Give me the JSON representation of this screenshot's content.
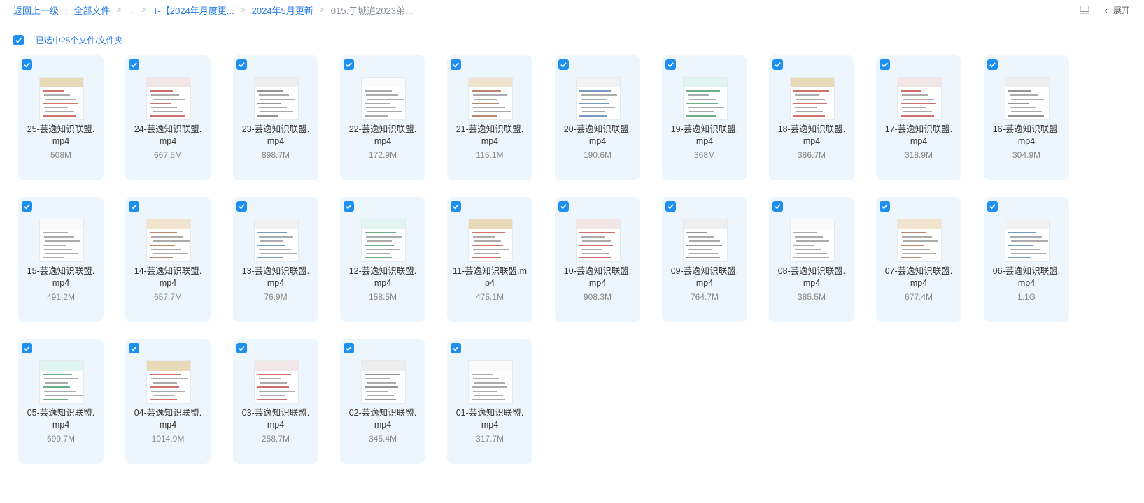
{
  "breadcrumb": {
    "back": "返回上一级",
    "all_files": "全部文件",
    "ellipsis": "...",
    "folder1": "T-【2024年月度更...",
    "folder2": "2024年5月更新",
    "current": "015.于城道2023弟..."
  },
  "toolbar": {
    "expand_label": "展开",
    "list_icon": "list-view-icon",
    "back_icon": "chevron-left-icon"
  },
  "selection": {
    "text": "已选中25个文件/文件夹",
    "checked": true
  },
  "colors": {
    "accent": "#2a7ee8",
    "card_bg": "#eef6fd",
    "checkbox": "#1f8fef"
  },
  "files": [
    {
      "name_line1": "25-芸逸知识联盟.",
      "name_line2": "mp4",
      "size": "508M"
    },
    {
      "name_line1": "24-芸逸知识联盟.",
      "name_line2": "mp4",
      "size": "667.5M"
    },
    {
      "name_line1": "23-芸逸知识联盟.",
      "name_line2": "mp4",
      "size": "898.7M"
    },
    {
      "name_line1": "22-芸逸知识联盟.",
      "name_line2": "mp4",
      "size": "172.9M"
    },
    {
      "name_line1": "21-芸逸知识联盟.",
      "name_line2": "mp4",
      "size": "115.1M"
    },
    {
      "name_line1": "20-芸逸知识联盟.",
      "name_line2": "mp4",
      "size": "190.6M"
    },
    {
      "name_line1": "19-芸逸知识联盟.",
      "name_line2": "mp4",
      "size": "368M"
    },
    {
      "name_line1": "18-芸逸知识联盟.",
      "name_line2": "mp4",
      "size": "386.7M"
    },
    {
      "name_line1": "17-芸逸知识联盟.",
      "name_line2": "mp4",
      "size": "318.9M"
    },
    {
      "name_line1": "16-芸逸知识联盟.",
      "name_line2": "mp4",
      "size": "304.9M"
    },
    {
      "name_line1": "15-芸逸知识联盟.",
      "name_line2": "mp4",
      "size": "491.2M"
    },
    {
      "name_line1": "14-芸逸知识联盟.",
      "name_line2": "mp4",
      "size": "657.7M"
    },
    {
      "name_line1": "13-芸逸知识联盟.",
      "name_line2": "mp4",
      "size": "76.9M"
    },
    {
      "name_line1": "12-芸逸知识联盟.",
      "name_line2": "mp4",
      "size": "158.5M"
    },
    {
      "name_line1": "11-芸逸知识联盟.m",
      "name_line2": "p4",
      "size": "475.1M"
    },
    {
      "name_line1": "10-芸逸知识联盟.",
      "name_line2": "mp4",
      "size": "908.3M"
    },
    {
      "name_line1": "09-芸逸知识联盟.",
      "name_line2": "mp4",
      "size": "764.7M"
    },
    {
      "name_line1": "08-芸逸知识联盟.",
      "name_line2": "mp4",
      "size": "385.5M"
    },
    {
      "name_line1": "07-芸逸知识联盟.",
      "name_line2": "mp4",
      "size": "677.4M"
    },
    {
      "name_line1": "06-芸逸知识联盟.",
      "name_line2": "mp4",
      "size": "1.1G"
    },
    {
      "name_line1": "05-芸逸知识联盟.",
      "name_line2": "mp4",
      "size": "699.7M"
    },
    {
      "name_line1": "04-芸逸知识联盟.",
      "name_line2": "mp4",
      "size": "1014.9M"
    },
    {
      "name_line1": "03-芸逸知识联盟.",
      "name_line2": "mp4",
      "size": "258.7M"
    },
    {
      "name_line1": "02-芸逸知识联盟.",
      "name_line2": "mp4",
      "size": "345.4M"
    },
    {
      "name_line1": "01-芸逸知识联盟.",
      "name_line2": "mp4",
      "size": "317.7M"
    }
  ]
}
